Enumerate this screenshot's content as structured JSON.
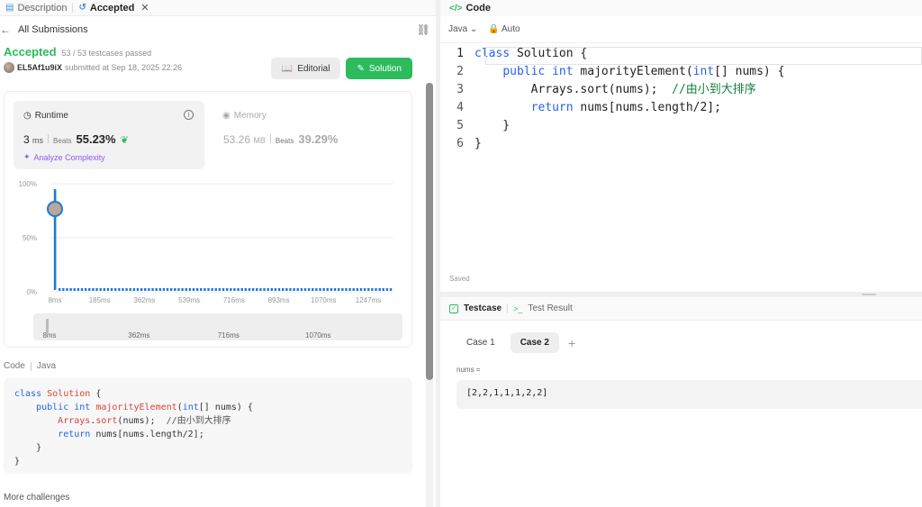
{
  "left_tabs": {
    "description": "Description",
    "accepted": "Accepted",
    "close": "✕"
  },
  "all_submissions": "All Submissions",
  "result": {
    "status": "Accepted",
    "testcases": "53 / 53 testcases passed",
    "username": "EL5Af1u9iX",
    "submitted": "submitted at Sep 18, 2025 22:26"
  },
  "buttons": {
    "editorial": "Editorial",
    "solution": "Solution"
  },
  "runtime": {
    "title": "Runtime",
    "value": "3",
    "unit": "ms",
    "beats_label": "Beats",
    "beats": "55.23%",
    "analyze": "Analyze Complexity"
  },
  "memory": {
    "title": "Memory",
    "value": "53.26",
    "unit": "MB",
    "beats_label": "Beats",
    "beats": "39.29%"
  },
  "chart_data": {
    "type": "bar",
    "y_ticks": [
      "100%",
      "50%",
      "0%"
    ],
    "x_ticks": [
      "8ms",
      "185ms",
      "362ms",
      "539ms",
      "716ms",
      "893ms",
      "1070ms",
      "1247ms"
    ],
    "x_range": [
      8,
      1247
    ],
    "y_range": [
      0,
      100
    ],
    "highlight": {
      "x": 8,
      "y": 85
    },
    "bars": [
      {
        "x": 8,
        "y": 85
      }
    ],
    "small_value": 1,
    "small_count": 90,
    "brush_ticks": [
      "8ms",
      "362ms",
      "716ms",
      "1070ms"
    ]
  },
  "code_section": {
    "label": "Code",
    "lang": "Java"
  },
  "submitted_code": [
    "class Solution {",
    "    public int majorityElement(int[] nums) {",
    "        Arrays.sort(nums);  //由小到大排序",
    "        return nums[nums.length/2];",
    "    }",
    "}"
  ],
  "more_challenges": "More challenges",
  "editor": {
    "title": "Code",
    "lang": "Java",
    "mode": "Auto",
    "saved": "Saved",
    "line_numbers": [
      "1",
      "2",
      "3",
      "4",
      "5",
      "6"
    ]
  },
  "testcase": {
    "tab_testcase": "Testcase",
    "tab_result": "Test Result",
    "case1": "Case 1",
    "case2": "Case 2",
    "plus": "+",
    "nums_label": "nums =",
    "nums_value": "[2,2,1,1,1,2,2]"
  },
  "colors": {
    "accent_green": "#2cbb5d",
    "chart_blue": "#1e7ad8",
    "purple": "#8b5cf6"
  }
}
